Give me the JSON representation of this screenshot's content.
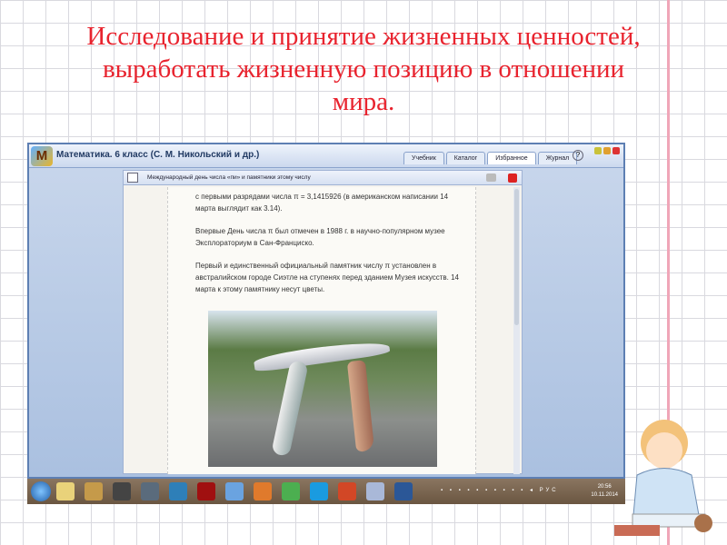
{
  "slide": {
    "title_lines": [
      "Исследование и принятие жизненных ценностей,",
      "выработать жизненную позицию в отношении",
      "мира."
    ]
  },
  "app": {
    "logo": "М",
    "title": "Математика. 6 класс (С. М. Никольский и др.)",
    "tabs": [
      {
        "label": "Учебник"
      },
      {
        "label": "Каталог"
      },
      {
        "label": "Избранное",
        "active": true
      },
      {
        "label": "Журнал"
      }
    ],
    "help": "?"
  },
  "document": {
    "title": "Международный день числа «пи» и памятники этому числу",
    "paragraphs": [
      "с первыми разрядами числа π = 3,1415926 (в американском написании 14 марта выглядит как 3.14).",
      "Впервые День числа π был отмечен в 1988 г. в научно-популярном музее Эксплораториум в Сан-Франциско.",
      "Первый и единственный официальный памятник числу π установлен в австралийском городе Сиэтле на ступенях перед зданием Музея искусств. 14 марта к этому памятнику несут цветы."
    ]
  },
  "taskbar": {
    "lang": "РУС",
    "time": "20:56",
    "date": "10.11.2014",
    "apps": [
      {
        "name": "explorer",
        "color": "#e9d27a"
      },
      {
        "name": "app2",
        "color": "#c59a4a"
      },
      {
        "name": "speaker-app",
        "color": "#444"
      },
      {
        "name": "app4",
        "color": "#5a6b7c"
      },
      {
        "name": "app5",
        "color": "#2e7fb8"
      },
      {
        "name": "power",
        "color": "#a01010"
      },
      {
        "name": "audio",
        "color": "#6aa3e0"
      },
      {
        "name": "app8",
        "color": "#e07a2c"
      },
      {
        "name": "chrome",
        "color": "#4caf50"
      },
      {
        "name": "skype",
        "color": "#1a9be0"
      },
      {
        "name": "powerpoint",
        "color": "#d24726"
      },
      {
        "name": "app12",
        "color": "#a9b8d8"
      },
      {
        "name": "word",
        "color": "#2b5797"
      }
    ]
  },
  "colors": {
    "title": "#e8232e",
    "pink_line": "#f0a6b8"
  }
}
